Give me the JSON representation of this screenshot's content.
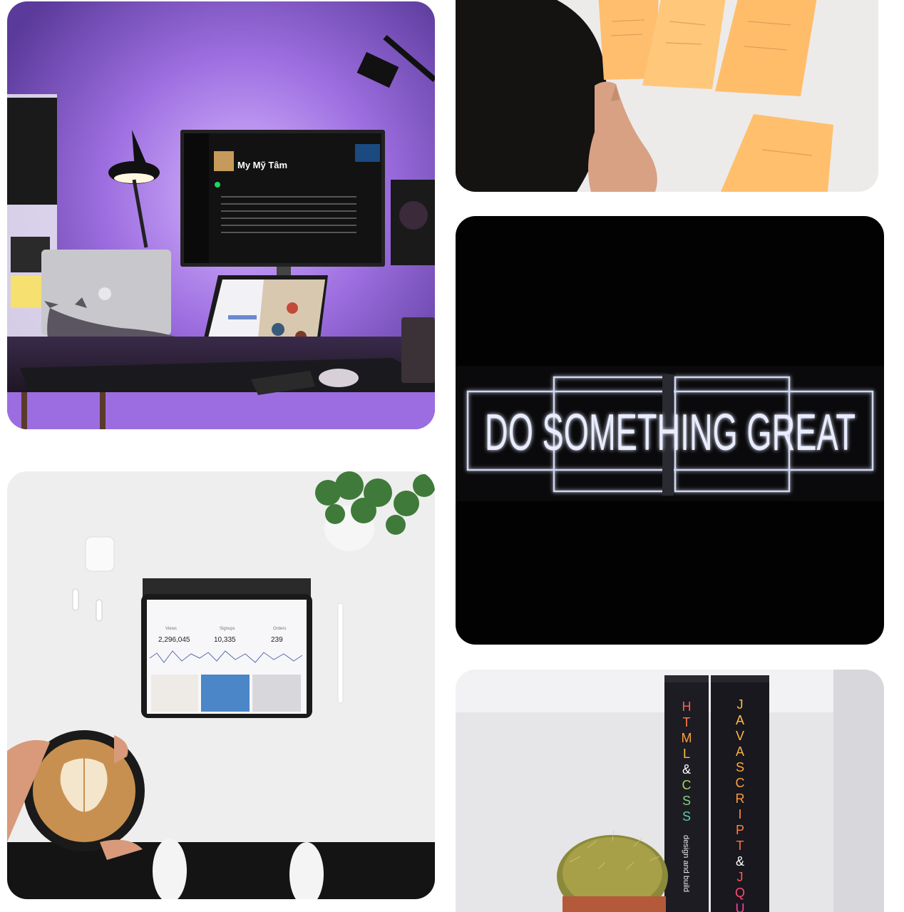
{
  "gallery": {
    "images": [
      {
        "name": "desk-setup-photo",
        "monitor_title": "My Mỹ Tâm"
      },
      {
        "name": "sticky-notes-photo"
      },
      {
        "name": "neon-sign-photo",
        "sign_text": "DO SOMETHING GREAT"
      },
      {
        "name": "flatlay-tablet-photo",
        "stats": [
          {
            "label": "Views",
            "value": "2,296,045"
          },
          {
            "label": "Signups",
            "value": "10,335"
          },
          {
            "label": "Orders",
            "value": "239"
          }
        ]
      },
      {
        "name": "books-cactus-photo",
        "book1_title": [
          "H",
          "T",
          "M",
          "L",
          "&",
          "C",
          "S",
          "S"
        ],
        "book1_subtitle": "design and build",
        "book2_title": [
          "J",
          "A",
          "V",
          "A",
          "S",
          "C",
          "R",
          "I",
          "P",
          "T",
          "&",
          "J",
          "Q",
          "U"
        ]
      }
    ]
  },
  "colors": {
    "purple_glow": "#a070e0",
    "neon_white": "#e8ecff",
    "sticky_orange": "#ffbe6e"
  }
}
